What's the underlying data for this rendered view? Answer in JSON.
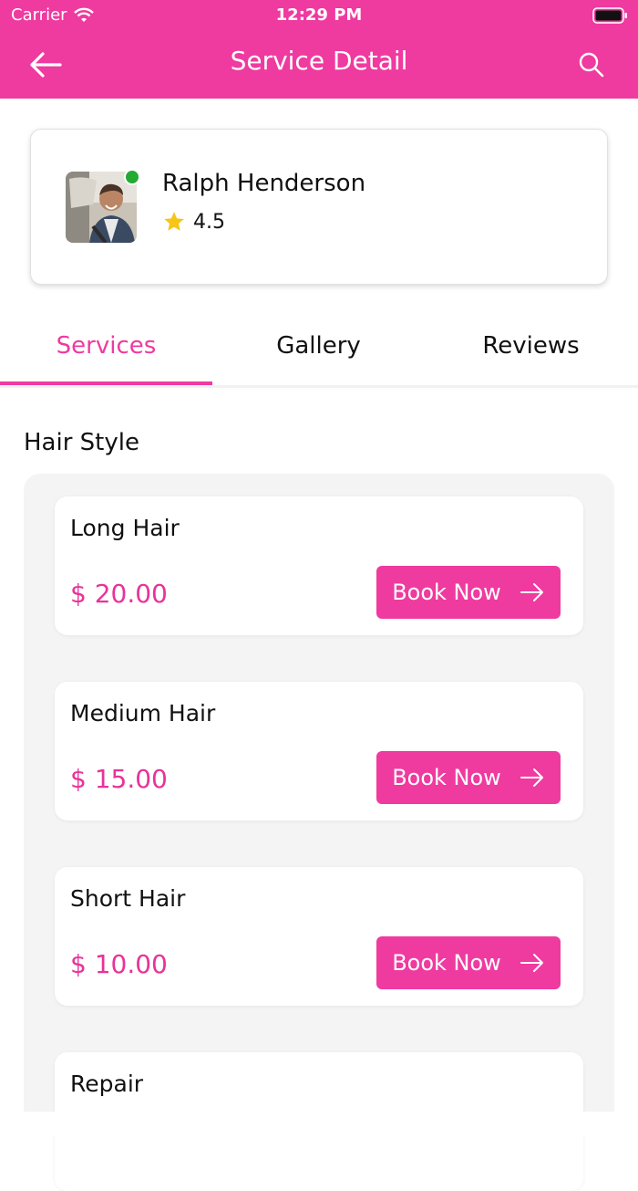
{
  "status_bar": {
    "carrier": "Carrier",
    "time": "12:29 PM"
  },
  "nav": {
    "title": "Service Detail",
    "back_icon": "arrow-left-icon",
    "search_icon": "search-icon"
  },
  "colors": {
    "brand": "#ef3aa0",
    "price": "#e8339a",
    "online": "#22aa33",
    "star": "#f5c518"
  },
  "provider": {
    "name": "Ralph Henderson",
    "rating": "4.5",
    "status": "online"
  },
  "tabs": [
    {
      "label": "Services",
      "active": true
    },
    {
      "label": "Gallery",
      "active": false
    },
    {
      "label": "Reviews",
      "active": false
    }
  ],
  "section": {
    "title": "Hair Style"
  },
  "services": [
    {
      "name": "Long Hair",
      "price": "$ 20.00",
      "button": "Book Now"
    },
    {
      "name": "Medium Hair",
      "price": "$ 15.00",
      "button": "Book Now"
    },
    {
      "name": "Short Hair",
      "price": "$ 10.00",
      "button": "Book Now"
    },
    {
      "name": "Repair",
      "price": "",
      "button": ""
    }
  ]
}
